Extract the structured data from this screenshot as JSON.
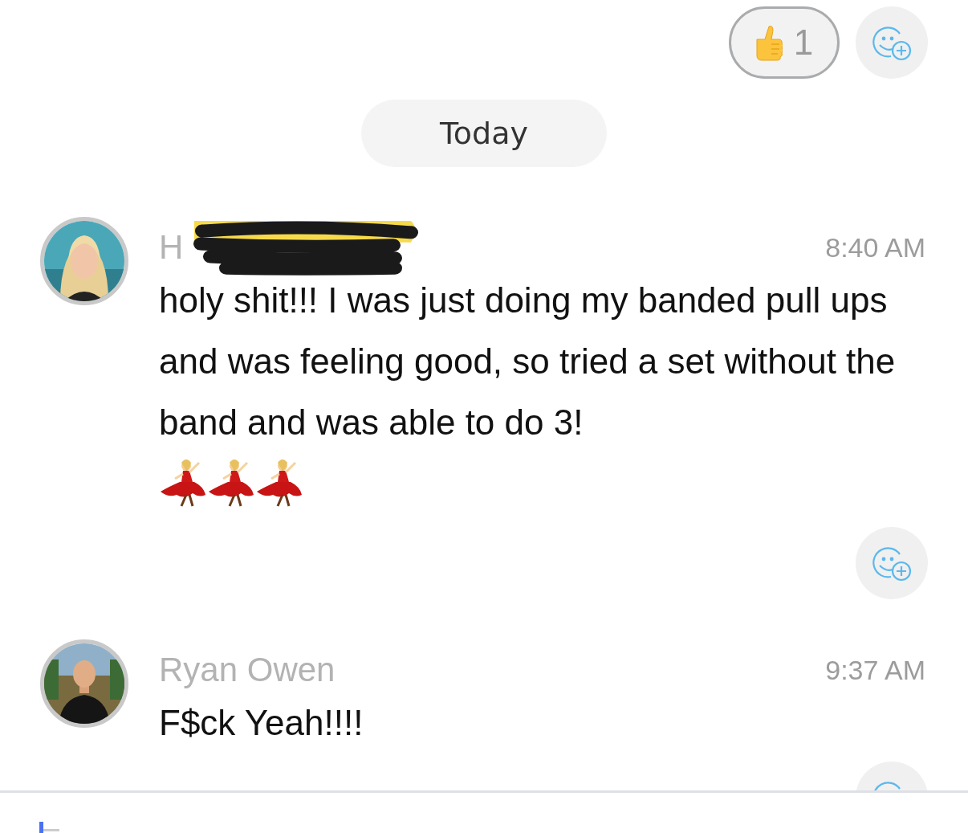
{
  "top_reactions": {
    "reactions": [
      {
        "kind": "thumbs_up",
        "count": "1",
        "selected": true
      }
    ],
    "add_reaction": true
  },
  "date_divider": {
    "label": "Today"
  },
  "messages": [
    {
      "sender": "H",
      "sender_redacted": true,
      "time": "8:40 AM",
      "text": "holy shit!!! I was just doing my banded pull ups and was feeling good, so tried a set without the band and was able to do 3!",
      "emojis": [
        {
          "kind": "dancer"
        },
        {
          "kind": "dancer"
        },
        {
          "kind": "dancer"
        }
      ],
      "add_reaction": true
    },
    {
      "sender": "Ryan Owen",
      "time": "9:37 AM",
      "text": "F$ck Yeah!!!!",
      "add_reaction": true
    }
  ],
  "composer": {
    "focused": true
  }
}
